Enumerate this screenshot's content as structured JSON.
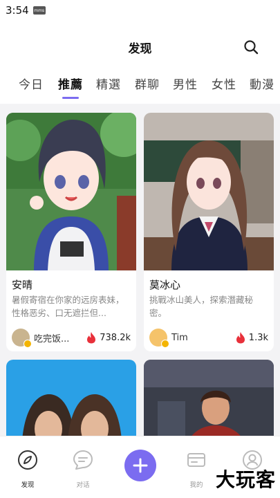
{
  "status": {
    "time": "3:54",
    "badge": "mms"
  },
  "header": {
    "title": "发现"
  },
  "tabs": [
    "今日",
    "推薦",
    "精選",
    "群聊",
    "男性",
    "女性",
    "動漫"
  ],
  "cards": [
    {
      "name": "安晴",
      "desc": "暑假寄宿在你家的远房表妹，性格恶劣、口无遮拦但...",
      "author": "吃完饭...",
      "count": "738.2k"
    },
    {
      "name": "莫冰心",
      "desc": "挑戰冰山美人，探索潛藏秘密。",
      "author": "Tim",
      "count": "1.3k"
    },
    {
      "name": "",
      "desc": "",
      "author": "",
      "count": ""
    },
    {
      "name": "",
      "desc": "",
      "author": "",
      "count": ""
    }
  ],
  "nav": {
    "discover": "发现",
    "chat": "对话",
    "mine": "我的",
    "profile": ""
  },
  "watermark": "大玩客",
  "colors": {
    "accent": "#7b6cf0",
    "fire": "#e8303a"
  }
}
